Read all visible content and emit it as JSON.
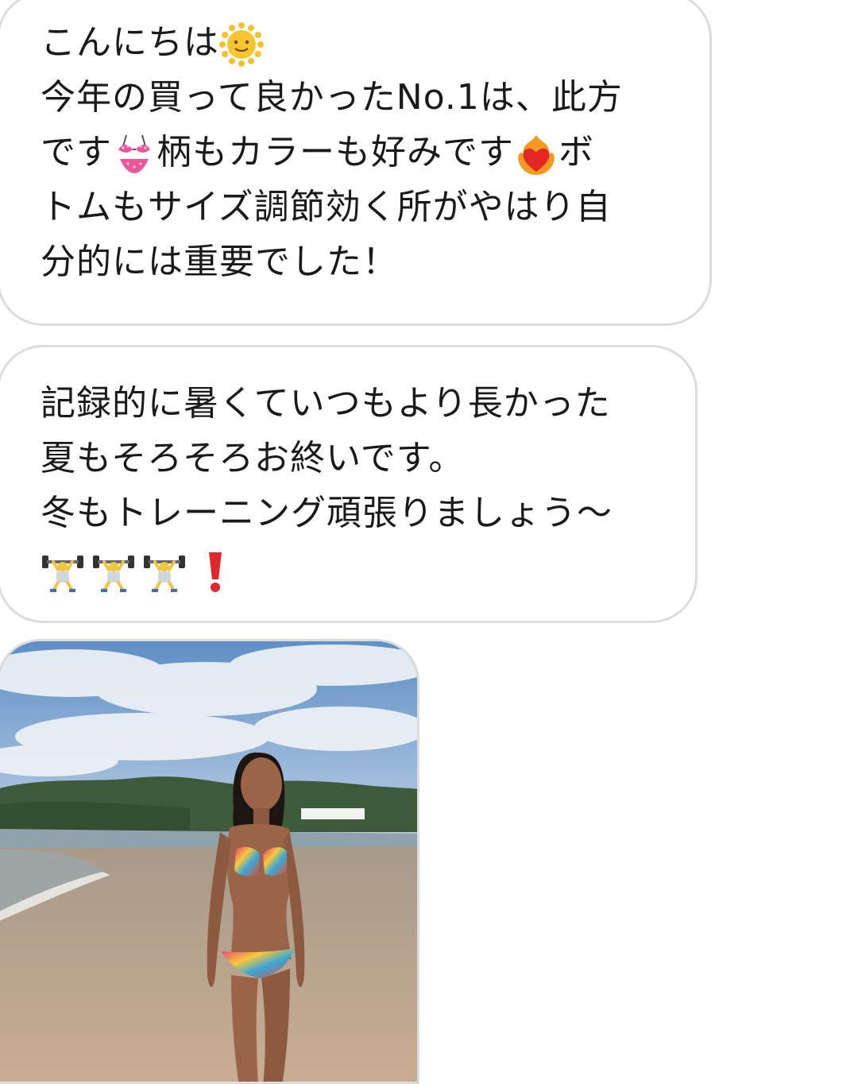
{
  "messages": [
    {
      "lines": [
        {
          "parts": [
            {
              "text": "こんにちは"
            },
            {
              "emoji": "sun-with-face"
            }
          ]
        },
        {
          "parts": [
            {
              "text": "今年の買って良かったNo.1は、此方"
            }
          ]
        },
        {
          "parts": [
            {
              "text": "です"
            },
            {
              "emoji": "bikini"
            },
            {
              "text": "柄もカラーも好みです"
            },
            {
              "emoji": "heart-on-fire"
            },
            {
              "text": "ボ"
            }
          ]
        },
        {
          "parts": [
            {
              "text": "トムもサイズ調節効く所がやはり自"
            }
          ]
        },
        {
          "parts": [
            {
              "text": "分的には重要でした！"
            }
          ]
        }
      ]
    },
    {
      "lines": [
        {
          "parts": [
            {
              "text": "記録的に暑くていつもより長かった"
            }
          ]
        },
        {
          "parts": [
            {
              "text": "夏もそろそろお終いです。"
            }
          ]
        },
        {
          "parts": [
            {
              "text": "冬もトレーニング頑張りましょう〜"
            }
          ]
        }
      ],
      "emoji_row": [
        "weight-lifter",
        "weight-lifter",
        "weight-lifter",
        "red-exclamation-mark"
      ]
    }
  ],
  "photo": {
    "subject": "beach-photo",
    "colors": {
      "sky": "#7fa8d6",
      "cloud": "#f2f5f8",
      "hills": "#3d5a3a",
      "sea": "#8fa3ad",
      "sand": "#c9b49a",
      "skin": "#9a6448",
      "hair": "#1c1512"
    }
  },
  "colors": {
    "bubble_border": "#dcdcdc",
    "text": "#1a1a1a",
    "background": "#ffffff"
  }
}
